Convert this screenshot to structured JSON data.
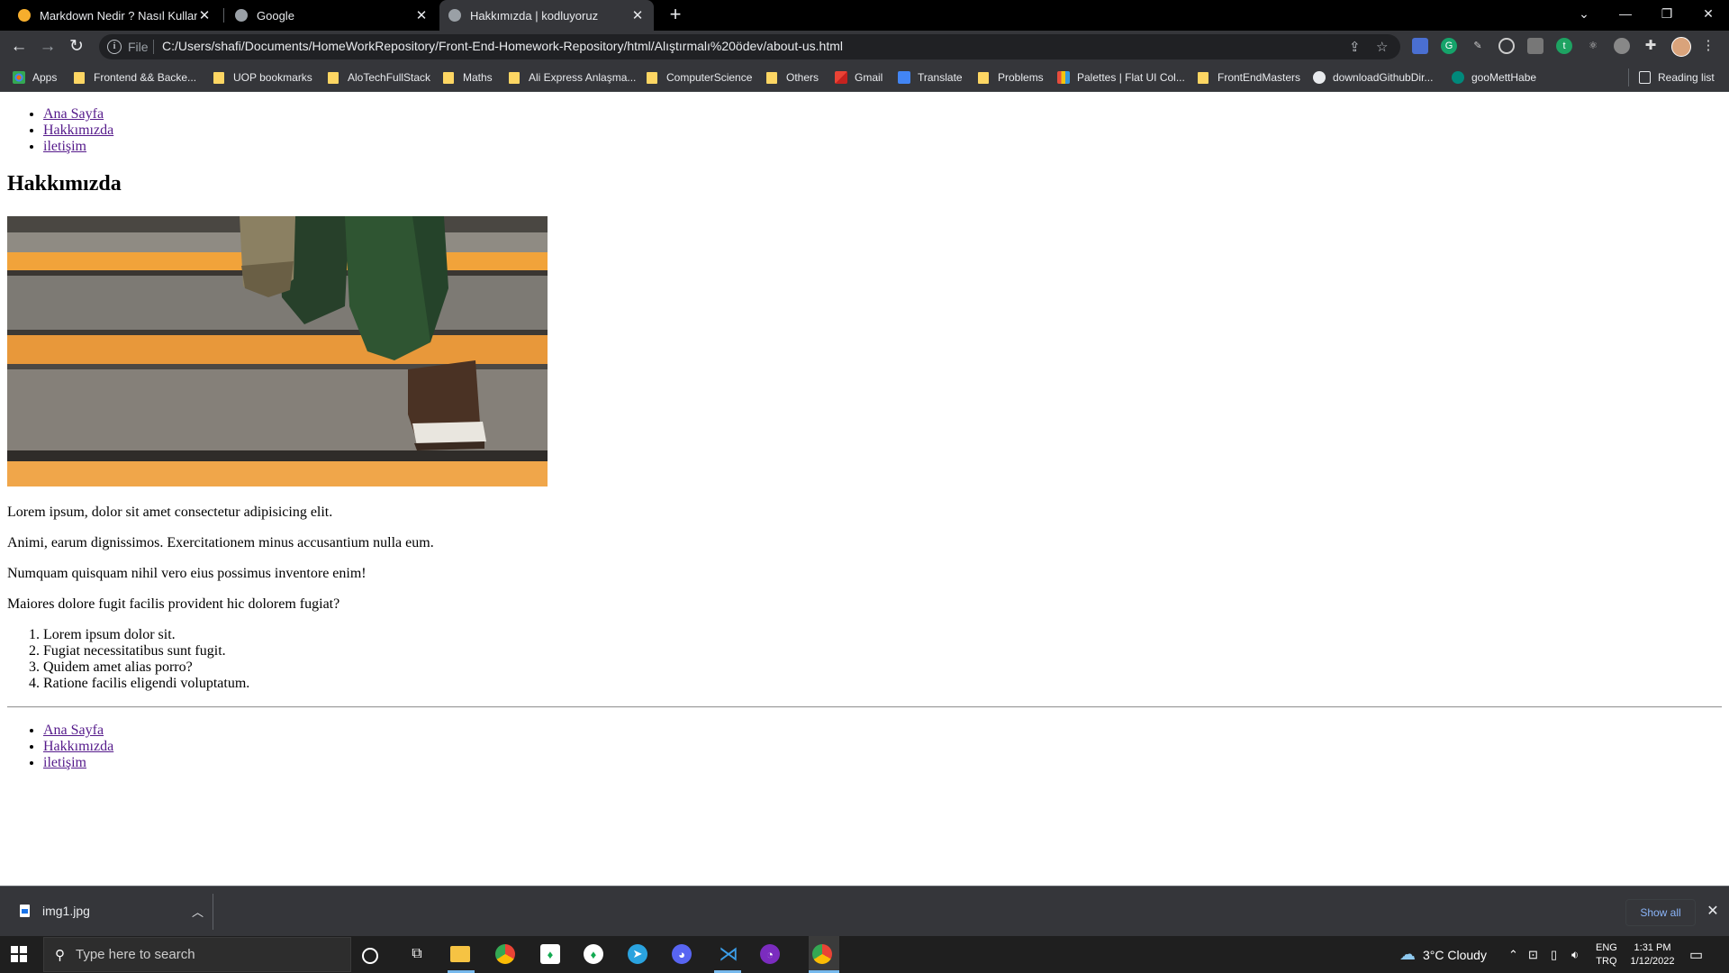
{
  "browser": {
    "tabs": [
      {
        "title": "Markdown Nedir ? Nasıl Kullanılır",
        "active": false
      },
      {
        "title": "Google",
        "active": false
      },
      {
        "title": "Hakkımızda | kodluyoruz",
        "active": true
      }
    ],
    "url_scheme": "File",
    "url": "C:/Users/shafi/Documents/HomeWorkRepository/Front-End-Homework-Repository/html/Alıştırmalı%20ödev/about-us.html",
    "bookmarks": [
      "Apps",
      "Frontend && Backe...",
      "UOP bookmarks",
      "AloTechFullStack",
      "Maths",
      "Ali Express Anlaşma...",
      "ComputerScience",
      "Others",
      "Gmail",
      "Translate",
      "Problems",
      "Palettes | Flat UI Col...",
      "FrontEndMasters",
      "downloadGithubDir...",
      "gooMettHabe"
    ],
    "reading_list": "Reading list"
  },
  "page": {
    "nav": [
      "Ana Sayfa",
      "Hakkımızda",
      "iletişim"
    ],
    "heading": "Hakkımızda",
    "paragraphs": [
      "Lorem ipsum, dolor sit amet consectetur adipisicing elit.",
      "Animi, earum dignissimos. Exercitationem minus accusantium nulla eum.",
      "Numquam quisquam nihil vero eius possimus inventore enim!",
      "Maiores dolore fugit facilis provident hic dolorem fugiat?"
    ],
    "ordered_list": [
      "Lorem ipsum dolor sit.",
      "Fugiat necessitatibus sunt fugit.",
      "Quidem amet alias porro?",
      "Ratione facilis eligendi voluptatum."
    ],
    "footer_nav": [
      "Ana Sayfa",
      "Hakkımızda",
      "iletişim"
    ]
  },
  "downloads": {
    "file": "img1.jpg",
    "show_all": "Show all"
  },
  "taskbar": {
    "search_placeholder": "Type here to search",
    "weather": "3°C  Cloudy",
    "lang": "ENG",
    "region": "TRQ",
    "time": "1:31 PM",
    "date": "1/12/2022"
  }
}
